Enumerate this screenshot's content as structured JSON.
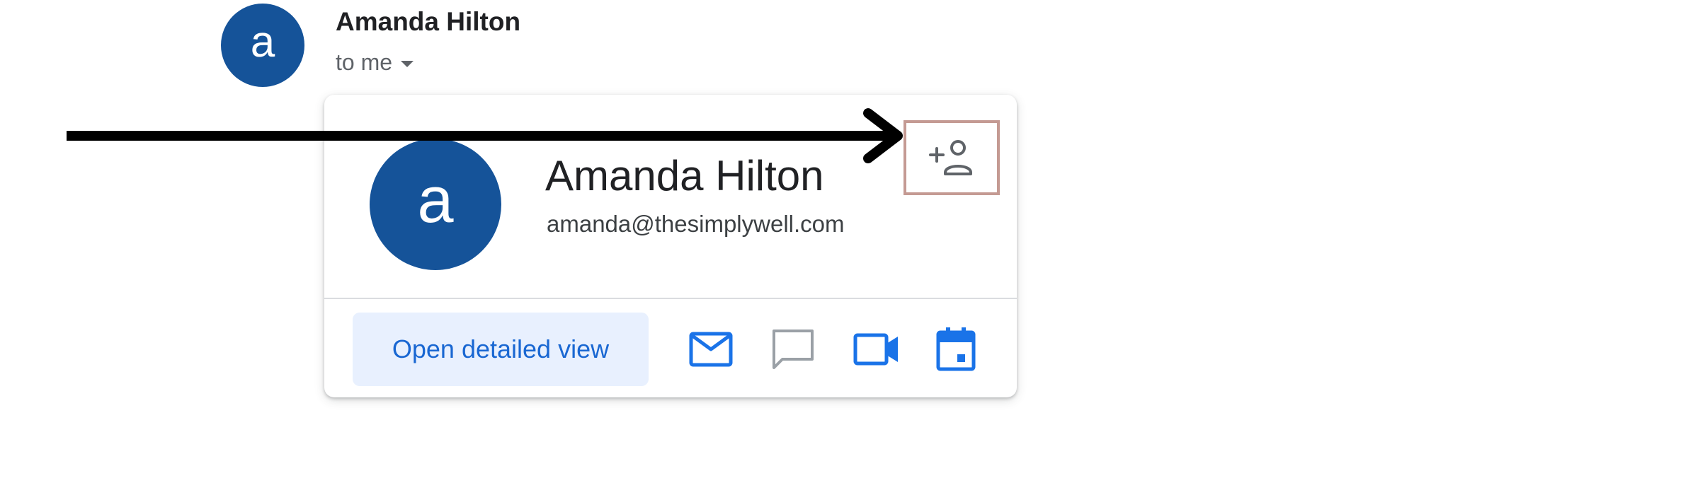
{
  "email_header": {
    "sender_initial": "a",
    "sender_name": "Amanda Hilton",
    "recipient_text": "to me",
    "recipient_dropdown_icon": "caret-down-icon"
  },
  "contact_card": {
    "avatar_initial": "a",
    "name": "Amanda Hilton",
    "email": "amanda@thesimplywell.com",
    "add_contact_icon": "add-person-icon",
    "open_detailed_label": "Open detailed view",
    "actions": [
      {
        "icon": "mail-icon",
        "color": "#1a73e8"
      },
      {
        "icon": "chat-icon",
        "color": "#9aa0a6"
      },
      {
        "icon": "video-call-icon",
        "color": "#1a73e8"
      },
      {
        "icon": "calendar-icon",
        "color": "#1a73e8"
      }
    ]
  },
  "annotation": {
    "arrow_icon": "arrow-right-icon",
    "highlight_color": "#c49a93"
  },
  "colors": {
    "avatar": "#155399",
    "accent": "#1967d2",
    "button_bg": "#e8f0fe"
  }
}
